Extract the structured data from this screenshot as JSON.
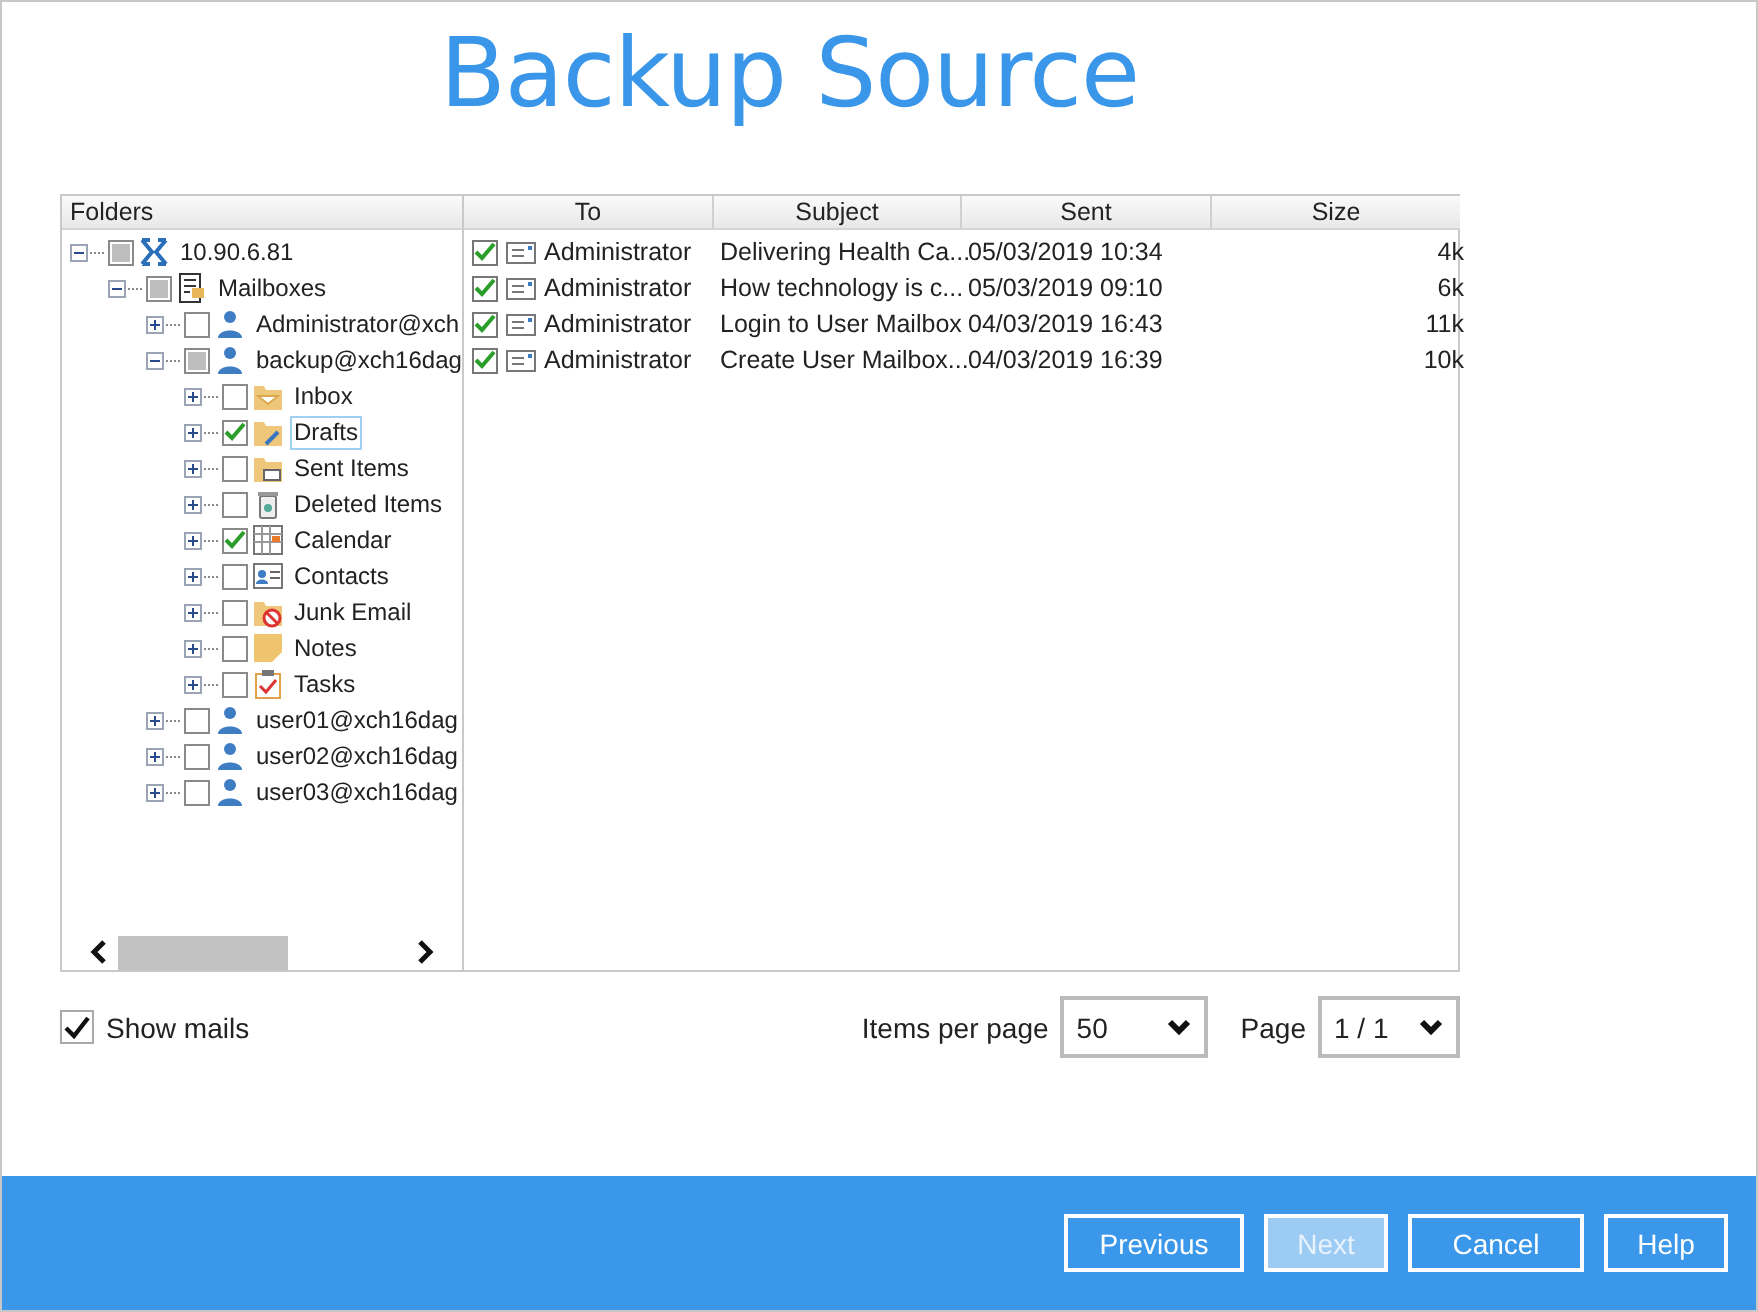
{
  "title": "Backup Source",
  "tree": {
    "header": "Folders",
    "nodes": [
      {
        "label": "10.90.6.81",
        "kind": "server",
        "checked": false,
        "partial": true,
        "expanded": true,
        "selected": false,
        "children": [
          {
            "label": "Mailboxes",
            "kind": "mailboxes",
            "checked": false,
            "partial": true,
            "expanded": true,
            "selected": false,
            "children": [
              {
                "label": "Administrator@xch",
                "kind": "user",
                "checked": false,
                "partial": false,
                "expanded": false,
                "selected": false
              },
              {
                "label": "backup@xch16dag",
                "kind": "user",
                "checked": false,
                "partial": true,
                "expanded": true,
                "selected": false,
                "children": [
                  {
                    "label": "Inbox",
                    "kind": "inbox",
                    "checked": false,
                    "partial": false,
                    "expanded": false,
                    "selected": false
                  },
                  {
                    "label": "Drafts",
                    "kind": "drafts",
                    "checked": true,
                    "partial": false,
                    "expanded": false,
                    "selected": true
                  },
                  {
                    "label": "Sent Items",
                    "kind": "sent",
                    "checked": false,
                    "partial": false,
                    "expanded": false,
                    "selected": false
                  },
                  {
                    "label": "Deleted Items",
                    "kind": "deleted",
                    "checked": false,
                    "partial": false,
                    "expanded": false,
                    "selected": false
                  },
                  {
                    "label": "Calendar",
                    "kind": "calendar",
                    "checked": true,
                    "partial": false,
                    "expanded": false,
                    "selected": false
                  },
                  {
                    "label": "Contacts",
                    "kind": "contacts",
                    "checked": false,
                    "partial": false,
                    "expanded": false,
                    "selected": false
                  },
                  {
                    "label": "Junk Email",
                    "kind": "junk",
                    "checked": false,
                    "partial": false,
                    "expanded": false,
                    "selected": false
                  },
                  {
                    "label": "Notes",
                    "kind": "notes",
                    "checked": false,
                    "partial": false,
                    "expanded": false,
                    "selected": false
                  },
                  {
                    "label": "Tasks",
                    "kind": "tasks",
                    "checked": false,
                    "partial": false,
                    "expanded": false,
                    "selected": false
                  }
                ]
              },
              {
                "label": "user01@xch16dag",
                "kind": "user",
                "checked": false,
                "partial": false,
                "expanded": false,
                "selected": false
              },
              {
                "label": "user02@xch16dag",
                "kind": "user",
                "checked": false,
                "partial": false,
                "expanded": false,
                "selected": false
              },
              {
                "label": "user03@xch16dag",
                "kind": "user",
                "checked": false,
                "partial": false,
                "expanded": false,
                "selected": false
              }
            ]
          }
        ]
      }
    ]
  },
  "mails": {
    "columns": [
      "To",
      "Subject",
      "Sent",
      "Size"
    ],
    "rows": [
      {
        "checked": true,
        "to": "Administrator",
        "subject": "Delivering Health Ca...",
        "sent": "05/03/2019 10:34",
        "size": "4k"
      },
      {
        "checked": true,
        "to": "Administrator",
        "subject": "How technology is c...",
        "sent": "05/03/2019 09:10",
        "size": "6k"
      },
      {
        "checked": true,
        "to": "Administrator",
        "subject": "Login to User Mailbox",
        "sent": "04/03/2019 16:43",
        "size": "11k"
      },
      {
        "checked": true,
        "to": "Administrator",
        "subject": "Create User Mailbox...",
        "sent": "04/03/2019 16:39",
        "size": "10k"
      }
    ]
  },
  "show_mails": {
    "label": "Show mails",
    "checked": true
  },
  "items_per_page": {
    "label": "Items per page",
    "value": "50"
  },
  "page": {
    "label": "Page",
    "value": "1 / 1"
  },
  "buttons": [
    {
      "label": "Previous",
      "disabled": false
    },
    {
      "label": "Next",
      "disabled": true
    },
    {
      "label": "Cancel",
      "disabled": false
    },
    {
      "label": "Help",
      "disabled": false
    }
  ]
}
